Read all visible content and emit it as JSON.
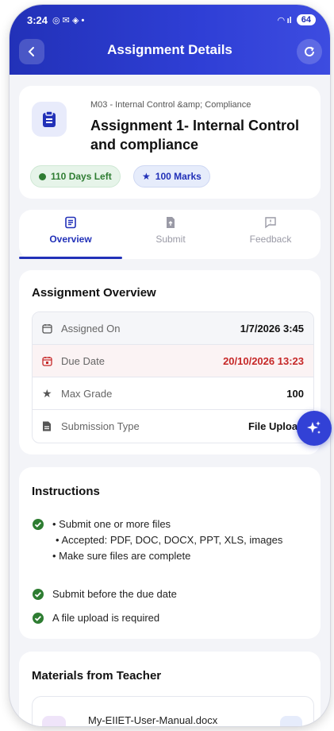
{
  "status_bar": {
    "time": "3:24",
    "battery": "64"
  },
  "header": {
    "title": "Assignment Details"
  },
  "assignment": {
    "module": "M03 - Internal Control &amp; Compliance",
    "title": "Assignment 1- Internal Control and compliance",
    "days_left": "110 Days Left",
    "marks": "100 Marks"
  },
  "tabs": [
    {
      "label": "Overview",
      "active": true
    },
    {
      "label": "Submit",
      "active": false
    },
    {
      "label": "Feedback",
      "active": false
    }
  ],
  "overview": {
    "title": "Assignment Overview",
    "rows": [
      {
        "label": "Assigned On",
        "value": "1/7/2026 3:45"
      },
      {
        "label": "Due Date",
        "value": "20/10/2026 13:23"
      },
      {
        "label": "Max Grade",
        "value": "100"
      },
      {
        "label": "Submission Type",
        "value": "File Upload"
      }
    ]
  },
  "instructions": {
    "title": "Instructions",
    "item1_lines": [
      "• Submit one or more files",
      "• Accepted: PDF, DOC, DOCX, PPT, XLS, images",
      "• Make sure files are complete"
    ],
    "item2": "Submit before the due date",
    "item3": "A file upload is required"
  },
  "materials": {
    "title": "Materials from Teacher",
    "file_name": "My-EIIET-User-Manual.docx"
  },
  "colors": {
    "primary": "#2231b8",
    "success": "#2e7d32",
    "danger": "#c62828"
  }
}
